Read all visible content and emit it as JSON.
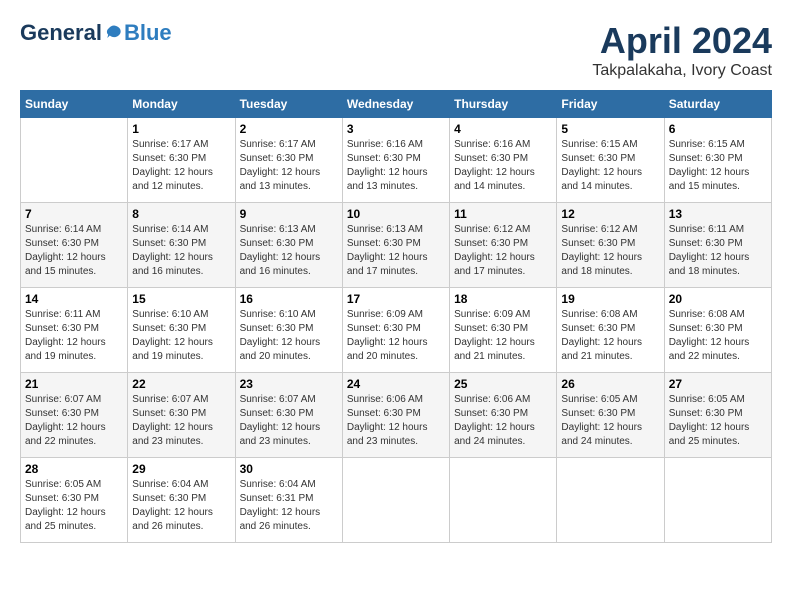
{
  "logo": {
    "general": "General",
    "blue": "Blue"
  },
  "header": {
    "month": "April 2024",
    "location": "Takpalakaha, Ivory Coast"
  },
  "weekdays": [
    "Sunday",
    "Monday",
    "Tuesday",
    "Wednesday",
    "Thursday",
    "Friday",
    "Saturday"
  ],
  "weeks": [
    [
      {
        "day": "",
        "text": ""
      },
      {
        "day": "1",
        "text": "Sunrise: 6:17 AM\nSunset: 6:30 PM\nDaylight: 12 hours\nand 12 minutes."
      },
      {
        "day": "2",
        "text": "Sunrise: 6:17 AM\nSunset: 6:30 PM\nDaylight: 12 hours\nand 13 minutes."
      },
      {
        "day": "3",
        "text": "Sunrise: 6:16 AM\nSunset: 6:30 PM\nDaylight: 12 hours\nand 13 minutes."
      },
      {
        "day": "4",
        "text": "Sunrise: 6:16 AM\nSunset: 6:30 PM\nDaylight: 12 hours\nand 14 minutes."
      },
      {
        "day": "5",
        "text": "Sunrise: 6:15 AM\nSunset: 6:30 PM\nDaylight: 12 hours\nand 14 minutes."
      },
      {
        "day": "6",
        "text": "Sunrise: 6:15 AM\nSunset: 6:30 PM\nDaylight: 12 hours\nand 15 minutes."
      }
    ],
    [
      {
        "day": "7",
        "text": "Sunrise: 6:14 AM\nSunset: 6:30 PM\nDaylight: 12 hours\nand 15 minutes."
      },
      {
        "day": "8",
        "text": "Sunrise: 6:14 AM\nSunset: 6:30 PM\nDaylight: 12 hours\nand 16 minutes."
      },
      {
        "day": "9",
        "text": "Sunrise: 6:13 AM\nSunset: 6:30 PM\nDaylight: 12 hours\nand 16 minutes."
      },
      {
        "day": "10",
        "text": "Sunrise: 6:13 AM\nSunset: 6:30 PM\nDaylight: 12 hours\nand 17 minutes."
      },
      {
        "day": "11",
        "text": "Sunrise: 6:12 AM\nSunset: 6:30 PM\nDaylight: 12 hours\nand 17 minutes."
      },
      {
        "day": "12",
        "text": "Sunrise: 6:12 AM\nSunset: 6:30 PM\nDaylight: 12 hours\nand 18 minutes."
      },
      {
        "day": "13",
        "text": "Sunrise: 6:11 AM\nSunset: 6:30 PM\nDaylight: 12 hours\nand 18 minutes."
      }
    ],
    [
      {
        "day": "14",
        "text": "Sunrise: 6:11 AM\nSunset: 6:30 PM\nDaylight: 12 hours\nand 19 minutes."
      },
      {
        "day": "15",
        "text": "Sunrise: 6:10 AM\nSunset: 6:30 PM\nDaylight: 12 hours\nand 19 minutes."
      },
      {
        "day": "16",
        "text": "Sunrise: 6:10 AM\nSunset: 6:30 PM\nDaylight: 12 hours\nand 20 minutes."
      },
      {
        "day": "17",
        "text": "Sunrise: 6:09 AM\nSunset: 6:30 PM\nDaylight: 12 hours\nand 20 minutes."
      },
      {
        "day": "18",
        "text": "Sunrise: 6:09 AM\nSunset: 6:30 PM\nDaylight: 12 hours\nand 21 minutes."
      },
      {
        "day": "19",
        "text": "Sunrise: 6:08 AM\nSunset: 6:30 PM\nDaylight: 12 hours\nand 21 minutes."
      },
      {
        "day": "20",
        "text": "Sunrise: 6:08 AM\nSunset: 6:30 PM\nDaylight: 12 hours\nand 22 minutes."
      }
    ],
    [
      {
        "day": "21",
        "text": "Sunrise: 6:07 AM\nSunset: 6:30 PM\nDaylight: 12 hours\nand 22 minutes."
      },
      {
        "day": "22",
        "text": "Sunrise: 6:07 AM\nSunset: 6:30 PM\nDaylight: 12 hours\nand 23 minutes."
      },
      {
        "day": "23",
        "text": "Sunrise: 6:07 AM\nSunset: 6:30 PM\nDaylight: 12 hours\nand 23 minutes."
      },
      {
        "day": "24",
        "text": "Sunrise: 6:06 AM\nSunset: 6:30 PM\nDaylight: 12 hours\nand 23 minutes."
      },
      {
        "day": "25",
        "text": "Sunrise: 6:06 AM\nSunset: 6:30 PM\nDaylight: 12 hours\nand 24 minutes."
      },
      {
        "day": "26",
        "text": "Sunrise: 6:05 AM\nSunset: 6:30 PM\nDaylight: 12 hours\nand 24 minutes."
      },
      {
        "day": "27",
        "text": "Sunrise: 6:05 AM\nSunset: 6:30 PM\nDaylight: 12 hours\nand 25 minutes."
      }
    ],
    [
      {
        "day": "28",
        "text": "Sunrise: 6:05 AM\nSunset: 6:30 PM\nDaylight: 12 hours\nand 25 minutes."
      },
      {
        "day": "29",
        "text": "Sunrise: 6:04 AM\nSunset: 6:30 PM\nDaylight: 12 hours\nand 26 minutes."
      },
      {
        "day": "30",
        "text": "Sunrise: 6:04 AM\nSunset: 6:31 PM\nDaylight: 12 hours\nand 26 minutes."
      },
      {
        "day": "",
        "text": ""
      },
      {
        "day": "",
        "text": ""
      },
      {
        "day": "",
        "text": ""
      },
      {
        "day": "",
        "text": ""
      }
    ]
  ]
}
